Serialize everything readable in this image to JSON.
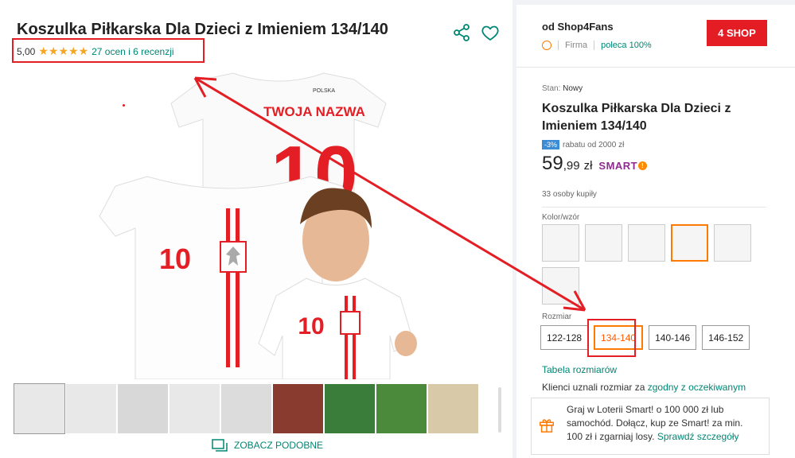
{
  "product": {
    "title": "Koszulka Piłkarska Dla Dzieci z Imieniem 134/140",
    "rating_value": "5,00",
    "stars": "★★★★★",
    "rating_link": "27 ocen i 6 recenzji",
    "similar_label": "ZOBACZ PODOBNE",
    "shirt_back_text": "TWOJA NAZWA",
    "shirt_number": "10",
    "shirt_brand": "POLSKA"
  },
  "thumbnails": [
    "thumb-1",
    "thumb-2",
    "thumb-3",
    "thumb-4",
    "thumb-5",
    "thumb-6",
    "thumb-7",
    "thumb-8",
    "thumb-9"
  ],
  "seller": {
    "name": "od Shop4Fans",
    "logo_text": "4 SHOP",
    "type": "Firma",
    "recommend": "poleca 100%"
  },
  "offer": {
    "stan_label": "Stan:",
    "stan_value": "Nowy",
    "title": "Koszulka Piłkarska Dla Dzieci z Imieniem 134/140",
    "discount_badge": "-3%",
    "discount_text": "rabatu od 2000 zł",
    "price_int": "59",
    "price_frac": ",99",
    "currency": "zł",
    "smart_label": "SMART",
    "smart_mark": "!",
    "bought": "33 osoby kupiły",
    "color_label": "Kolor/wzór",
    "size_label": "Rozmiar",
    "sizes": [
      "122-128",
      "134-140",
      "140-146",
      "146-152"
    ],
    "size_table": "Tabela rozmiarów",
    "fit_prefix": "Klienci uznali rozmiar za ",
    "fit_link": "zgodny z oczekiwanym",
    "promo_text": "Graj w Loterii Smart! o 100 000 zł lub samochód. Dołącz, kup ze Smart! za min. 100 zł i zgarniaj losy. ",
    "promo_link": "Sprawdź szczegóły"
  },
  "colors": {
    "accent": "#008673",
    "orange": "#ff7a00",
    "annotation_red": "#e31e24",
    "shirt_red": "#e31e24"
  }
}
